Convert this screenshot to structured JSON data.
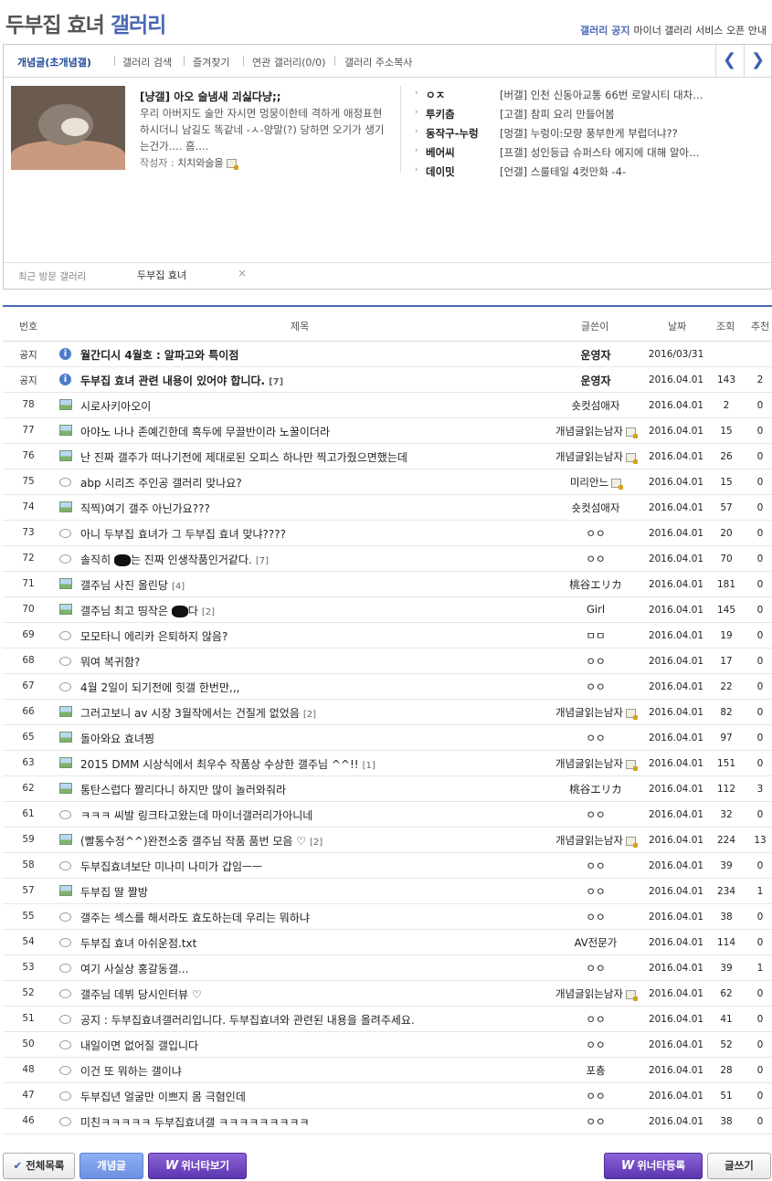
{
  "header": {
    "title_main": "두부집 효녀 ",
    "title_suffix": "갤러리",
    "notice_label": "갤러리 공지",
    "notice_text": "마이너 갤러리 서비스 오픈 안내"
  },
  "tabs": [
    {
      "label": "개념글(초개념갤)"
    },
    {
      "label": "갤러리 검색"
    },
    {
      "label": "즐겨찾기"
    },
    {
      "label": "연관 갤러리(0/0)"
    },
    {
      "label": "갤러리 주소복사"
    }
  ],
  "nav": {
    "prev": "❮",
    "next": "❯"
  },
  "featured": {
    "title": "[냥갤] 아오 술냄새 괴싫다냥;;",
    "text": "우리 아버지도 술만 자시면 멍뭉이한테 격하게 애정표현하시더니 남길도 똑같네 -ㅅ-양말(?) 당하면 오기가 생기는건가.... 흠....",
    "author_label": "작성자 : ",
    "author": "치치와술을"
  },
  "hot_list": [
    {
      "name": "ㅇㅈ",
      "post": "[버갤] 인천 신동아교통 66번 로얄시티 대차…"
    },
    {
      "name": "투키츰",
      "post": "[고갤] 참피 요리 만들어봄"
    },
    {
      "name": "동작구-누렁",
      "post": "[멍갤] 누렁이:모량 풍부한게 부럽더냐??"
    },
    {
      "name": "베어씨",
      "post": "[프갤] 성인등급 슈퍼스타 에지에 대해 알아…"
    },
    {
      "name": "데이밋",
      "post": "[언갤] 스룰테일 4컷만화 -4-"
    }
  ],
  "recent": {
    "label": "최근 방문 갤러리",
    "item": "두부집 효녀",
    "close": "×"
  },
  "columns": {
    "num": "번호",
    "subject": "제목",
    "writer": "글쓴이",
    "date": "날짜",
    "views": "조회",
    "rec": "추천"
  },
  "rows": [
    {
      "num": "공지",
      "icon": "info",
      "subject": "월간디시 4월호 : 알파고와 특이점",
      "comments": "",
      "writer": "운영자",
      "lock": false,
      "date": "2016/03/31",
      "views": "",
      "rec": "",
      "bold": true
    },
    {
      "num": "공지",
      "icon": "info",
      "subject": "두부집 효녀 관련 내용이 있어야 합니다.",
      "comments": "[7]",
      "writer": "운영자",
      "lock": false,
      "date": "2016.04.01",
      "views": "143",
      "rec": "2",
      "bold": true
    },
    {
      "num": "78",
      "icon": "photo",
      "subject": "시로사키아오이",
      "comments": "",
      "writer": "숏컷섬애자",
      "lock": false,
      "date": "2016.04.01",
      "views": "2",
      "rec": "0"
    },
    {
      "num": "77",
      "icon": "photo",
      "subject": "아야노 나나 존예긴한데 흑두에 무끌반이라 노꿀이더라",
      "comments": "",
      "writer": "개념글읽는남자",
      "lock": true,
      "date": "2016.04.01",
      "views": "15",
      "rec": "0"
    },
    {
      "num": "76",
      "icon": "photo",
      "subject": "난 진짜 갤주가 떠나기전에 제대로된 오피스 하나만 찍고가줬으면했는데",
      "comments": "",
      "writer": "개념글읽는남자",
      "lock": true,
      "date": "2016.04.01",
      "views": "26",
      "rec": "0"
    },
    {
      "num": "75",
      "icon": "text",
      "subject": "abp 시리즈 주인공 갤러리 맞나요?",
      "comments": "",
      "writer": "미리안느",
      "lock": true,
      "date": "2016.04.01",
      "views": "15",
      "rec": "0"
    },
    {
      "num": "74",
      "icon": "photo",
      "subject": "직찍)여기 갤주 아닌가요???",
      "comments": "",
      "writer": "숏컷섬애자",
      "lock": false,
      "date": "2016.04.01",
      "views": "57",
      "rec": "0"
    },
    {
      "num": "73",
      "icon": "text",
      "subject": "아니 두부집 효녀가 그 두부집 효녀 맞냐????",
      "comments": "",
      "writer": "ㅇㅇ",
      "lock": false,
      "date": "2016.04.01",
      "views": "20",
      "rec": "0"
    },
    {
      "num": "72",
      "icon": "text",
      "subject": "솔직히 ",
      "subject_after": "는 진짜 인생작품인거같다.",
      "redact": true,
      "comments": "[7]",
      "writer": "ㅇㅇ",
      "lock": false,
      "date": "2016.04.01",
      "views": "70",
      "rec": "0"
    },
    {
      "num": "71",
      "icon": "photo",
      "subject": "갤주님 사진 올린당",
      "comments": "[4]",
      "writer": "桃谷エリカ",
      "lock": false,
      "date": "2016.04.01",
      "views": "181",
      "rec": "0"
    },
    {
      "num": "70",
      "icon": "photo",
      "subject": "갤주님 최고 띵작은 ",
      "subject_after": "다",
      "redact": true,
      "comments": "[2]",
      "writer": "Girl",
      "lock": false,
      "date": "2016.04.01",
      "views": "145",
      "rec": "0"
    },
    {
      "num": "69",
      "icon": "text",
      "subject": "모모타니 에리카 은퇴하지 않음?",
      "comments": "",
      "writer": "ㅁㅁ",
      "lock": false,
      "date": "2016.04.01",
      "views": "19",
      "rec": "0"
    },
    {
      "num": "68",
      "icon": "text",
      "subject": "뭐여 복귀함?",
      "comments": "",
      "writer": "ㅇㅇ",
      "lock": false,
      "date": "2016.04.01",
      "views": "17",
      "rec": "0"
    },
    {
      "num": "67",
      "icon": "text",
      "subject": "4월 2일이 되기전에 힛갤 한번만,,,",
      "comments": "",
      "writer": "ㅇㅇ",
      "lock": false,
      "date": "2016.04.01",
      "views": "22",
      "rec": "0"
    },
    {
      "num": "66",
      "icon": "photo",
      "subject": "그러고보니 av 시장 3월작에서는 건질게 없었음",
      "comments": "[2]",
      "writer": "개념글읽는남자",
      "lock": true,
      "date": "2016.04.01",
      "views": "82",
      "rec": "0"
    },
    {
      "num": "65",
      "icon": "photo",
      "subject": "돌아와요 효녀찡",
      "comments": "",
      "writer": "ㅇㅇ",
      "lock": false,
      "date": "2016.04.01",
      "views": "97",
      "rec": "0"
    },
    {
      "num": "63",
      "icon": "photo",
      "subject": "2015 DMM 시상식에서 최우수 작품상 수상한 갤주님 ^^!!",
      "comments": "[1]",
      "writer": "개념글읽는남자",
      "lock": true,
      "date": "2016.04.01",
      "views": "151",
      "rec": "0"
    },
    {
      "num": "62",
      "icon": "photo",
      "subject": "통탄스럽다 짤리다니 하지만 많이 놀러와줘라",
      "comments": "",
      "writer": "桃谷エリカ",
      "lock": false,
      "date": "2016.04.01",
      "views": "112",
      "rec": "3"
    },
    {
      "num": "61",
      "icon": "text",
      "subject": "ㅋㅋㅋ 씨발 링크타고왔는데 마이너갤러리가아니네",
      "comments": "",
      "writer": "ㅇㅇ",
      "lock": false,
      "date": "2016.04.01",
      "views": "32",
      "rec": "0"
    },
    {
      "num": "59",
      "icon": "photo",
      "subject": "(빨통수정^^)완전소중 갤주님 작품 품번 모음 ♡",
      "comments": "[2]",
      "writer": "개념글읽는남자",
      "lock": true,
      "date": "2016.04.01",
      "views": "224",
      "rec": "13"
    },
    {
      "num": "58",
      "icon": "text",
      "subject": "두부집효녀보단 미나미 나미가 갑임ㅡㅡ",
      "comments": "",
      "writer": "ㅇㅇ",
      "lock": false,
      "date": "2016.04.01",
      "views": "39",
      "rec": "0"
    },
    {
      "num": "57",
      "icon": "photo",
      "subject": "두부집 딸 짤방",
      "comments": "",
      "writer": "ㅇㅇ",
      "lock": false,
      "date": "2016.04.01",
      "views": "234",
      "rec": "1"
    },
    {
      "num": "55",
      "icon": "text",
      "subject": "갤주는 섹스를 해서라도 효도하는데 우리는 뭐하냐",
      "comments": "",
      "writer": "ㅇㅇ",
      "lock": false,
      "date": "2016.04.01",
      "views": "38",
      "rec": "0"
    },
    {
      "num": "54",
      "icon": "text",
      "subject": "두부집 효녀 아쉬운점.txt",
      "comments": "",
      "writer": "AV전문가",
      "lock": false,
      "date": "2016.04.01",
      "views": "114",
      "rec": "0"
    },
    {
      "num": "53",
      "icon": "text",
      "subject": "여기 사실상 홍갈동갤...",
      "comments": "",
      "writer": "ㅇㅇ",
      "lock": false,
      "date": "2016.04.01",
      "views": "39",
      "rec": "1"
    },
    {
      "num": "52",
      "icon": "text",
      "subject": "갤주님 데뷔 당시인터뷰 ♡",
      "comments": "",
      "writer": "개념글읽는남자",
      "lock": true,
      "date": "2016.04.01",
      "views": "62",
      "rec": "0"
    },
    {
      "num": "51",
      "icon": "text",
      "subject": "공지 : 두부집효녀갤러리입니다. 두부집효녀와 관련된 내용을 올려주세요.",
      "comments": "",
      "writer": "ㅇㅇ",
      "lock": false,
      "date": "2016.04.01",
      "views": "41",
      "rec": "0"
    },
    {
      "num": "50",
      "icon": "text",
      "subject": "내일이면 없어질 갤입니다",
      "comments": "",
      "writer": "ㅇㅇ",
      "lock": false,
      "date": "2016.04.01",
      "views": "52",
      "rec": "0"
    },
    {
      "num": "48",
      "icon": "text",
      "subject": "이건 또 뭐하는 갤이냐",
      "comments": "",
      "writer": "포춍",
      "lock": false,
      "date": "2016.04.01",
      "views": "28",
      "rec": "0"
    },
    {
      "num": "47",
      "icon": "text",
      "subject": "두부집년 얼굴만 이쁘지 몸 극혐인데",
      "comments": "",
      "writer": "ㅇㅇ",
      "lock": false,
      "date": "2016.04.01",
      "views": "51",
      "rec": "0"
    },
    {
      "num": "46",
      "icon": "text",
      "subject": "미친ㅋㅋㅋㅋㅋ 두부집효녀갤 ㅋㅋㅋㅋㅋㅋㅋㅋㅋ",
      "comments": "",
      "writer": "ㅇㅇ",
      "lock": false,
      "date": "2016.04.01",
      "views": "38",
      "rec": "0"
    }
  ],
  "buttons": {
    "all_list": "전체목록",
    "concept": "개념글",
    "winner_view": "위너타보기",
    "winner_register": "위너타등록",
    "write": "글쓰기",
    "w_mark": "W",
    "check_mark": "✔",
    "info_mark": "i"
  }
}
